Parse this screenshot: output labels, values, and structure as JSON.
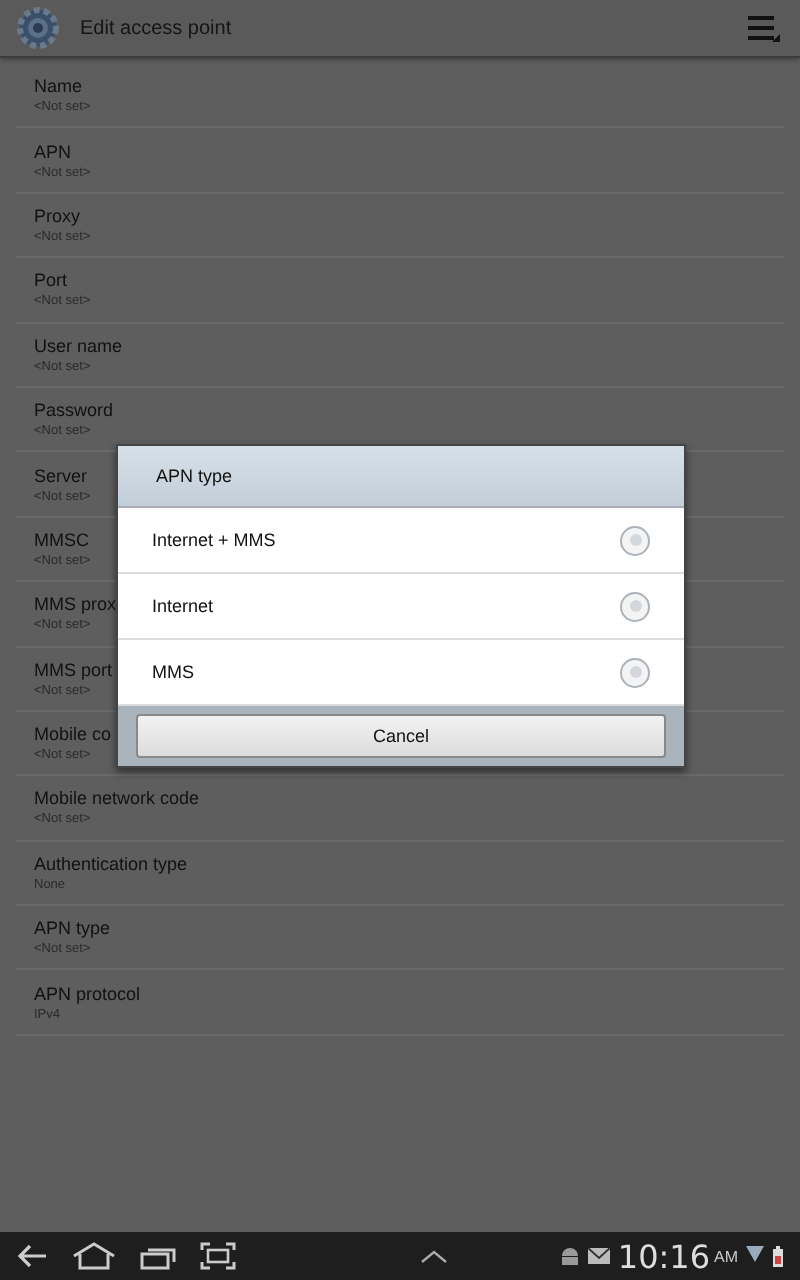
{
  "title_bar": {
    "title": "Edit access point"
  },
  "settings": [
    {
      "label": "Name",
      "value": "<Not set>"
    },
    {
      "label": "APN",
      "value": "<Not set>"
    },
    {
      "label": "Proxy",
      "value": "<Not set>"
    },
    {
      "label": "Port",
      "value": "<Not set>"
    },
    {
      "label": "User name",
      "value": "<Not set>"
    },
    {
      "label": "Password",
      "value": "<Not set>"
    },
    {
      "label": "Server",
      "value": "<Not set>"
    },
    {
      "label": "MMSC",
      "value": "<Not set>"
    },
    {
      "label": "MMS prox",
      "value": "<Not set>"
    },
    {
      "label": "MMS port",
      "value": "<Not set>"
    },
    {
      "label": "Mobile co",
      "value": "<Not set>"
    },
    {
      "label": "Mobile network code",
      "value": "<Not set>"
    },
    {
      "label": "Authentication type",
      "value": "None"
    },
    {
      "label": "APN type",
      "value": "<Not set>"
    },
    {
      "label": "APN protocol",
      "value": "IPv4"
    }
  ],
  "dialog": {
    "title": "APN type",
    "options": [
      {
        "label": "Internet + MMS",
        "selected": false
      },
      {
        "label": "Internet",
        "selected": false
      },
      {
        "label": "MMS",
        "selected": false
      }
    ],
    "cancel": "Cancel"
  },
  "status_bar": {
    "time": "10:16",
    "ampm": "AM"
  }
}
